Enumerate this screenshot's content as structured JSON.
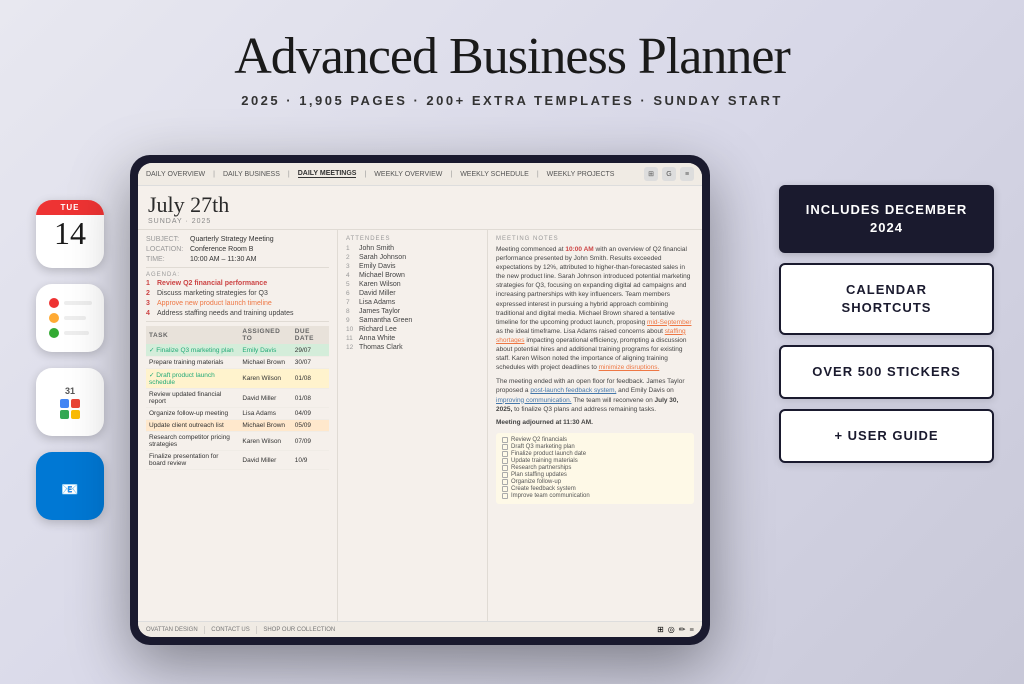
{
  "header": {
    "title": "Advanced Business Planner",
    "subtitle": "2025  ·  1,905 PAGES  ·  200+ EXTRA TEMPLATES  ·  SUNDAY START"
  },
  "calendar_app": {
    "day": "TUE",
    "date": "14"
  },
  "nav": {
    "items": [
      {
        "label": "DAILY OVERVIEW",
        "active": false
      },
      {
        "label": "DAILY BUSINESS",
        "active": false
      },
      {
        "label": "DAILY MEETINGS",
        "active": true
      },
      {
        "label": "WEEKLY OVERVIEW",
        "active": false
      },
      {
        "label": "WEEKLY SCHEDULE",
        "active": false
      },
      {
        "label": "WEEKLY PROJECTS",
        "active": false
      }
    ]
  },
  "meeting": {
    "date": "July 27th",
    "date_sub": "SUNDAY · 2025",
    "subject_label": "SUBJECT:",
    "subject": "Quarterly Strategy Meeting",
    "location_label": "LOCATION:",
    "location": "Conference Room B",
    "time_label": "TIME:",
    "time": "10:00 AM – 11:30 AM",
    "agenda_label": "AGENDA:",
    "agenda": [
      "Review Q2 financial performance",
      "Discuss marketing strategies for Q3",
      "Approve new product launch timeline",
      "Address staffing needs and training updates"
    ],
    "attendees_label": "ATTENDEES",
    "attendees": [
      "John Smith",
      "Sarah Johnson",
      "Emily Davis",
      "Michael Brown",
      "Karen Wilson",
      "David Miller",
      "Lisa Adams",
      "James Taylor",
      "Samantha Green",
      "Richard Lee",
      "Anna White",
      "Thomas Clark"
    ],
    "notes_label": "MEETING NOTES",
    "notes_para1": "Meeting commenced at 10:00 AM with an overview of Q2 financial performance presented by John Smith. Results exceeded expectations by 12%, attributed to higher-than-forecasted sales in the new product line. Sarah Johnson introduced potential marketing strategies for Q3, focusing on expanding digital ad campaigns and increasing partnerships with key influencers. Team members expressed interest in pursuing a hybrid approach combining traditional and digital media. Michael Brown shared a tentative timeline for the upcoming product launch, proposing mid-September as the ideal timeframe. Lisa Adams raised concerns about staffing shortages impacting operational efficiency, prompting a discussion about potential hires and additional training programs for existing staff. Karen Wilson noted the importance of aligning training schedules with project deadlines to minimize disruptions.",
    "notes_para2": "The meeting ended with an open floor for feedback. James Taylor proposed a post-launch feedback system, and Emily Davis on improving communication. The team will reconvene on July 30, 2025, to finalize Q3 plans and address remaining tasks.",
    "notes_footer": "Meeting adjourned at 11:30 AM."
  },
  "tasks": {
    "header_task": "TASK",
    "header_assigned": "ASSIGNED TO",
    "header_due": "DUE DATE",
    "rows": [
      {
        "name": "✓ Finalize Q3 marketing plan",
        "assigned": "Emily Davis",
        "due": "29/07",
        "style": "green"
      },
      {
        "name": "Prepare training materials",
        "assigned": "Michael Brown",
        "due": "30/07",
        "style": "none"
      },
      {
        "name": "✓ Draft product launch schedule",
        "assigned": "Karen Wilson",
        "due": "01/08",
        "style": "yellow"
      },
      {
        "name": "Review updated financial report",
        "assigned": "David Miller",
        "due": "01/08",
        "style": "none"
      },
      {
        "name": "Organize follow-up meeting",
        "assigned": "Lisa Adams",
        "due": "04/09",
        "style": "none"
      },
      {
        "name": "Update client outreach list",
        "assigned": "Michael Brown",
        "due": "05/09",
        "style": "orange"
      },
      {
        "name": "Research competitor pricing strategies",
        "assigned": "Karen Wilson",
        "due": "07/09",
        "style": "none"
      },
      {
        "name": "Finalize presentation for board review",
        "assigned": "David Miller",
        "due": "10/9",
        "style": "none"
      }
    ]
  },
  "checklist": {
    "items": [
      "Review Q2 financials",
      "Draft Q3 marketing plan",
      "Finalize product launch date",
      "Update training materials",
      "Research partnerships",
      "Plan staffing updates",
      "Organize follow-up",
      "Create feedback system",
      "Improve team communication"
    ]
  },
  "feature_cards": [
    {
      "label": "INCLUDES DECEMBER 2024",
      "dark": true
    },
    {
      "label": "CALENDAR SHORTCUTS",
      "dark": false
    },
    {
      "label": "OVER 500 STICKERS",
      "dark": false
    },
    {
      "label": "+ USER GUIDE",
      "dark": false
    }
  ],
  "footer_links": [
    "OVATTAN DESIGN",
    "CONTACT US",
    "SHOP OUR COLLECTION"
  ]
}
